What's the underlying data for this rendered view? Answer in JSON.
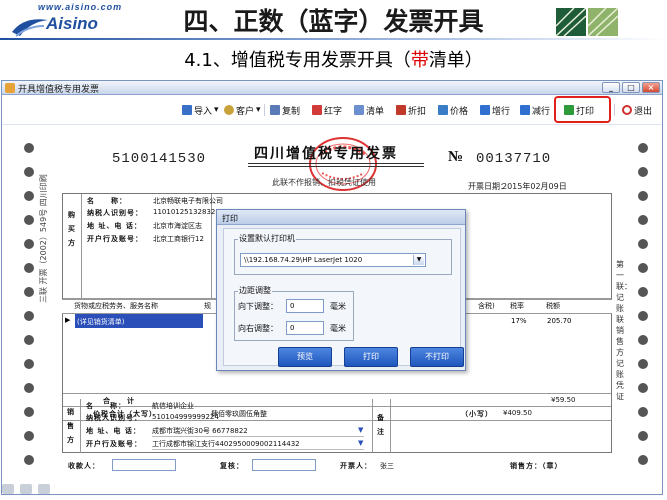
{
  "slide": {
    "brand_url": "www.aisino.com",
    "brand_name": "Aisino",
    "title": "四、正数（蓝字）发票开具",
    "subtitle_prefix": "4.1、增值税专用发票开具（",
    "subtitle_highlight": "带",
    "subtitle_suffix": "清单）"
  },
  "window": {
    "title": "开具增值税专用发票",
    "min_label": "_",
    "max_label": "□",
    "close_label": "×"
  },
  "toolbar": {
    "import_label": "导入",
    "customer_label": "客户",
    "copy_label": "复制",
    "redletter_label": "红字",
    "list_label": "清单",
    "discount_label": "折扣",
    "price_label": "价格",
    "addrow_label": "增行",
    "delrow_label": "减行",
    "print_label": "打印",
    "exit_label": "退出"
  },
  "invoice": {
    "code": "5100141530",
    "heading": "四川增值税专用发票",
    "subheading": "此联不作报销、扣税凭证使用",
    "no_label": "№",
    "number": "00137710",
    "issue_date_label": "开票日期：",
    "issue_date": "2015年02月09日",
    "buyer_vertical": "购买方",
    "buyer": {
      "name_label": "名　　称：",
      "name": "北京畅联电子有限公司",
      "taxid_label": "纳税人识别号：",
      "taxid": "110101251328326",
      "addr_label": "地 址、电 话：",
      "addr": "北京市海淀区志",
      "bank_label": "开户行及账号：",
      "bank": "北京工商银行12"
    },
    "columns": {
      "goods": "货物或应税劳务、服务名称",
      "spec": "规",
      "tax_incl": "含税)",
      "rate": "税率",
      "tax": "税额"
    },
    "item": {
      "marker": "▶",
      "name": "(详见销货清单)",
      "rate": "17%",
      "tax": "205.70"
    },
    "total_label": "合　　计",
    "total_tax": "¥59.50",
    "grand_total_label": "价税合计（大写）",
    "grand_total_words": "肆佰零玖圆伍角整",
    "small_label": "（小写）",
    "small_value": "¥409.50",
    "seller_vertical": "销售方",
    "seller": {
      "name_label": "名　　称：",
      "name": "航信培训企业",
      "taxid_label": "纳税人识别号：",
      "taxid": "510104999999224",
      "addr_label": "地 址、电 话：",
      "addr": "成都市瑞兴街30号 66778822",
      "bank_label": "开户行及账号：",
      "bank": "工行成都市锦江支行4402950009002114432"
    },
    "remarks_vertical": "备注",
    "payee_label": "收款人：",
    "checker_label": "复核：",
    "drawer_label": "开票人：",
    "drawer": "张三",
    "seller_sign_label": "销售方：（章）",
    "left_side_text": "三联 开票（2002）549号 四川印刷",
    "right_side_text": "第一联：记账联 销售方记账凭证"
  },
  "print_dialog": {
    "title": "打印",
    "printer_group_label": "设置默认打印机",
    "printer_value": "\\\\192.168.74.29\\HP LaserJet 1020",
    "margin_group_label": "边距调整",
    "down_label": "向下调整：",
    "down_value": "0",
    "right_label": "向右调整：",
    "right_value": "0",
    "unit": "毫米",
    "preview_label": "预览",
    "print_label": "打印",
    "noprint_label": "不打印"
  },
  "colors": {
    "brand_blue": "#1f4f9f",
    "highlight_red": "#e0201a",
    "dialog_button_blue": "#1f56bd",
    "selection_blue": "#2a4fb8"
  }
}
